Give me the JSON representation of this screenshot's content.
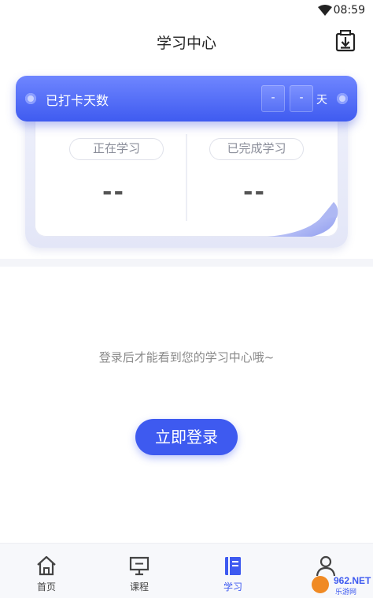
{
  "status_bar": {
    "time": "08:59",
    "wifi_icon": "wifi-icon"
  },
  "header": {
    "title": "学习中心",
    "download_icon": "download-icon"
  },
  "checkin": {
    "label": "已打卡天数",
    "day_digit_1": "-",
    "day_digit_2": "-",
    "unit": "天"
  },
  "stats": {
    "in_progress": {
      "label": "正在学习",
      "value": "--"
    },
    "completed": {
      "label": "已完成学习",
      "value": "--"
    }
  },
  "hint": "登录后才能看到您的学习中心哦~",
  "login_button": "立即登录",
  "bottom_nav": [
    {
      "label": "首页",
      "icon": "home-icon",
      "active": false
    },
    {
      "label": "课程",
      "icon": "monitor-icon",
      "active": false
    },
    {
      "label": "学习",
      "icon": "book-icon",
      "active": true
    },
    {
      "label": "",
      "icon": "user-icon",
      "active": false
    }
  ],
  "watermark": {
    "text": "962.NET 乐游网"
  },
  "colors": {
    "accent": "#3e5af0",
    "banner_top": "#6f86ff",
    "banner_bottom": "#3f5bf0"
  }
}
